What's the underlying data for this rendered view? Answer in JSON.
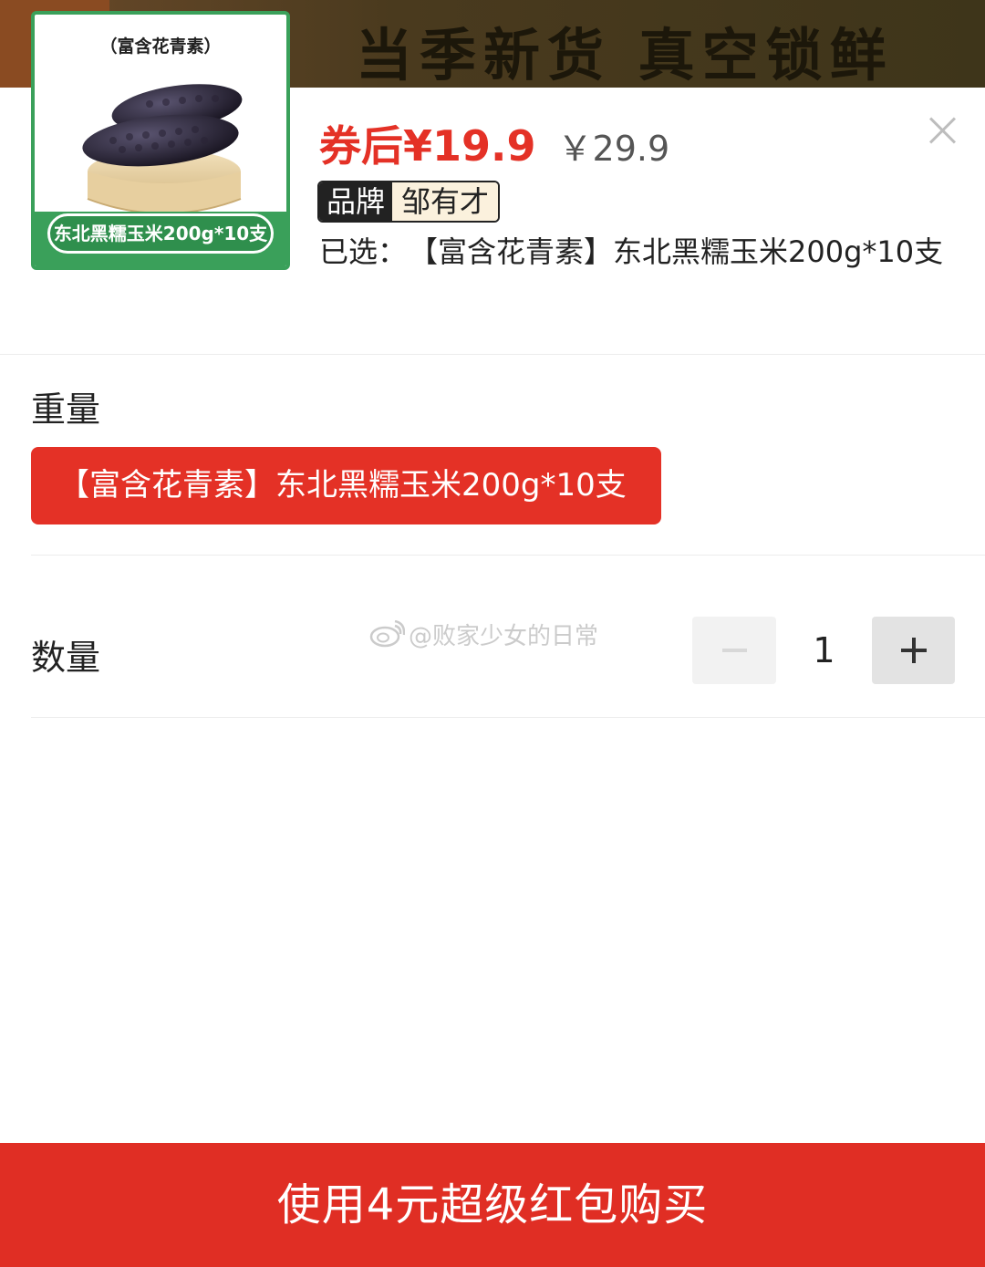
{
  "background_banner": {
    "text": "当季新货 真空锁鲜"
  },
  "product": {
    "thumbnail": {
      "top_label": "（富含花青素）",
      "bottom_label": "东北黑糯玉米200g*10支"
    },
    "price_after_coupon": "券后¥19.9",
    "original_price": "￥29.9",
    "brand_tag": "品牌",
    "brand_name": "邹有才",
    "selected_prefix": "已选：",
    "selected_value": "【富含花青素】东北黑糯玉米200g*10支"
  },
  "weight_section": {
    "title": "重量",
    "options": [
      {
        "label": "【富含花青素】东北黑糯玉米200g*10支",
        "selected": true
      }
    ]
  },
  "quantity_section": {
    "title": "数量",
    "value": "1",
    "minus_icon": "minus-icon",
    "plus_icon": "plus-icon"
  },
  "watermark": {
    "text": "@败家少女的日常",
    "icon": "weibo-logo"
  },
  "buy_button": {
    "label": "使用4元超级红包购买"
  },
  "colors": {
    "accent_red": "#e43126",
    "button_red": "#e02e24",
    "thumb_green": "#3aa05a",
    "brand_bg": "#fbf1dd"
  }
}
